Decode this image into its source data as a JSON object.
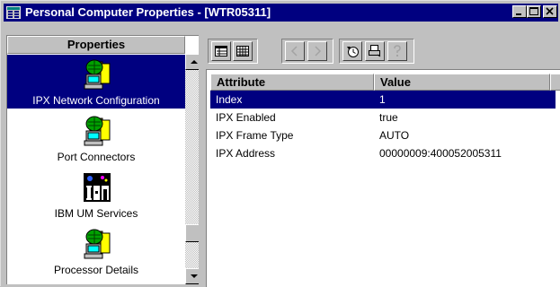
{
  "window": {
    "title": "Personal Computer Properties - [WTR05311]"
  },
  "left_pane": {
    "header": "Properties",
    "items": [
      {
        "label": "IPX Network Configuration",
        "icon": "computer-network-icon",
        "selected": true
      },
      {
        "label": "Port Connectors",
        "icon": "computer-network-icon",
        "selected": false
      },
      {
        "label": "IBM UM Services",
        "icon": "ibm-logo-icon",
        "selected": false
      },
      {
        "label": "Processor Details",
        "icon": "computer-network-icon",
        "selected": false
      }
    ]
  },
  "toolbar": {
    "buttons": [
      "details-view-icon",
      "grid-view-icon",
      "previous-icon",
      "next-icon",
      "refresh-clock-icon",
      "print-icon",
      "help-icon"
    ]
  },
  "grid": {
    "columns": [
      "Attribute",
      "Value"
    ],
    "rows": [
      {
        "attribute": "Index",
        "value": "1"
      },
      {
        "attribute": "IPX Enabled",
        "value": "true"
      },
      {
        "attribute": "IPX Frame Type",
        "value": "AUTO"
      },
      {
        "attribute": "IPX Address",
        "value": "00000009:400052005311"
      }
    ]
  },
  "colors": {
    "titlebar": "#000080",
    "selection": "#000080",
    "face": "#c0c0c0"
  }
}
